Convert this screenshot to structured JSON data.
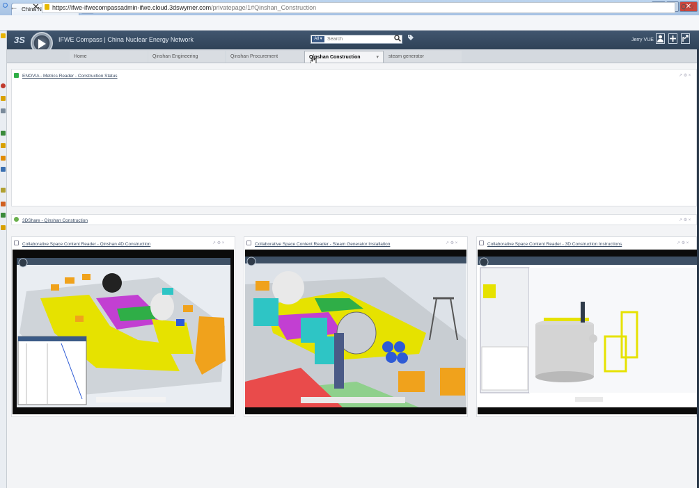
{
  "browser": {
    "tab_title": "China Nuclear Energy Net",
    "tab_close": "×",
    "url_host": "https://ifwe-ifwecompassadmin-ifwe.cloud.3dswymer.com",
    "url_path": "/privatepage/1#Qinshan_Construction",
    "url_tools": "Q ☆",
    "nav_back": "←",
    "nav_forward": "→",
    "nav_stop": "✕",
    "window_controls": [
      "–",
      "▫",
      "✕"
    ]
  },
  "app": {
    "logo_text": "3S",
    "title": "IFWE Compass | China Nuclear Energy Network",
    "search_scope": "All ▾",
    "search_placeholder": "Search",
    "search_icon": "search-icon",
    "user_name": "Jerry VUE",
    "header_icons": [
      "user-icon",
      "add-icon",
      "share-icon"
    ]
  },
  "nav": {
    "tabs": [
      {
        "label": "Home",
        "active": false
      },
      {
        "label": "Qinshan Engineering",
        "active": false
      },
      {
        "label": "Qinshan Procurement",
        "active": false
      },
      {
        "label": "Qinshan Construction",
        "active": true,
        "dropdown": "▾"
      },
      {
        "label": "steam generator",
        "active": false
      }
    ]
  },
  "panels": {
    "metrics": {
      "title": "ENOVIA - Metrics Reader - Construction Status",
      "icons": "↗ ⚙ ×"
    },
    "share": {
      "title": "3DShare - Qinshan Construction",
      "icons": "↗ ⚙ ×"
    },
    "readers": [
      {
        "title": "Collaborative Space Content Reader - Qinshan 4D Construction",
        "icons": "↗ ⚙ ×"
      },
      {
        "title": "Collaborative Space Content Reader - Steam Generator Installation",
        "icons": "↗ ⚙ ×"
      },
      {
        "title": "Collaborative Space Content Reader - 3D Construction Instructions",
        "icons": "↗ ⚙ ×"
      }
    ]
  },
  "colors": {
    "header_bg": "#3a4e66",
    "accent_yellow": "#e6e200",
    "accent_magenta": "#c23fd2",
    "accent_cyan": "#2ec5c5",
    "accent_orange": "#f0a21c",
    "accent_green": "#2fae47"
  }
}
